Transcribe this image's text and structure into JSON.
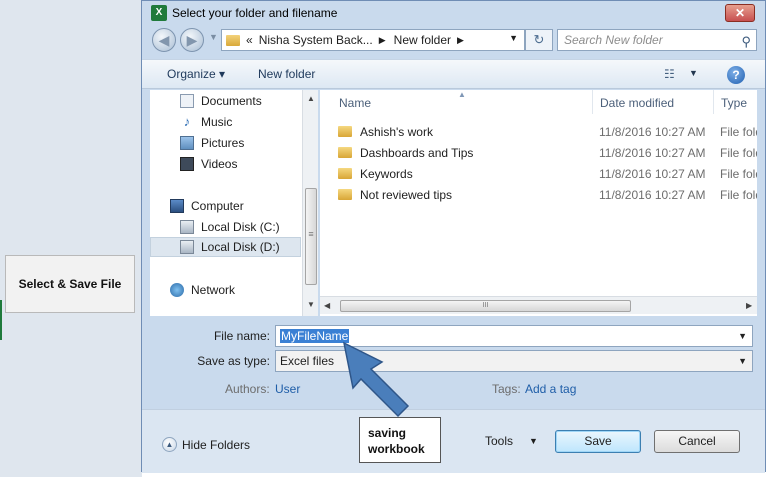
{
  "sheet": {
    "cell_label": "Select & Save File"
  },
  "dialog": {
    "title": "Select your folder and filename",
    "close_glyph": "✕",
    "nav": {
      "back_glyph": "◀",
      "forward_glyph": "▶",
      "dropdown_glyph": "▼",
      "address_prefix": "«",
      "address_segments": [
        "Nisha System Back...",
        "New folder"
      ],
      "address_sep_glyph": "▶",
      "refresh_glyph": "↻",
      "search_placeholder": "Search New folder",
      "search_glyph": "⚲"
    },
    "toolbar": {
      "organize_label": "Organize ▾",
      "new_folder_label": "New folder",
      "views_glyph": "☷",
      "views_dd_glyph": "▼",
      "help_glyph": "?"
    },
    "navpane": {
      "items": [
        {
          "label": "Documents",
          "icon": "documents-icon"
        },
        {
          "label": "Music",
          "icon": "music-icon"
        },
        {
          "label": "Pictures",
          "icon": "pictures-icon"
        },
        {
          "label": "Videos",
          "icon": "videos-icon"
        },
        {
          "label": "Computer",
          "icon": "computer-icon"
        },
        {
          "label": "Local Disk (C:)",
          "icon": "disk-icon"
        },
        {
          "label": "Local Disk (D:)",
          "icon": "disk-icon",
          "selected": true
        },
        {
          "label": "Network",
          "icon": "network-icon"
        }
      ],
      "scroll_up_glyph": "▲",
      "scroll_down_glyph": "▼",
      "grip_glyph": "≡"
    },
    "files": {
      "columns": [
        "Name",
        "Date modified",
        "Type"
      ],
      "sort_glyph": "▲",
      "rows": [
        {
          "name": "Ashish's work",
          "date": "11/8/2016 10:27 AM",
          "type": "File folder"
        },
        {
          "name": "Dashboards and Tips",
          "date": "11/8/2016 10:27 AM",
          "type": "File folder"
        },
        {
          "name": "Keywords",
          "date": "11/8/2016 10:27 AM",
          "type": "File folder"
        },
        {
          "name": "Not reviewed tips",
          "date": "11/8/2016 10:27 AM",
          "type": "File folder"
        }
      ],
      "hscroll_left_glyph": "◀",
      "hscroll_right_glyph": "▶",
      "hscroll_grip_glyph": "III"
    },
    "save_form": {
      "filename_label": "File name:",
      "filename_value": "MyFileName",
      "savetype_label": "Save as type:",
      "savetype_value": "Excel files",
      "dd_glyph": "▼",
      "authors_label": "Authors:",
      "authors_value": "User",
      "tags_label": "Tags:",
      "tags_value": "Add a tag"
    },
    "footer": {
      "hide_folders_label": "Hide Folders",
      "hide_glyph": "▲",
      "tools_label": "Tools",
      "tools_dd_glyph": "▼",
      "save_label": "Save",
      "cancel_label": "Cancel"
    }
  },
  "callout": {
    "line1": "saving",
    "line2": "workbook",
    "arrow_color": "#4a7ebb"
  }
}
